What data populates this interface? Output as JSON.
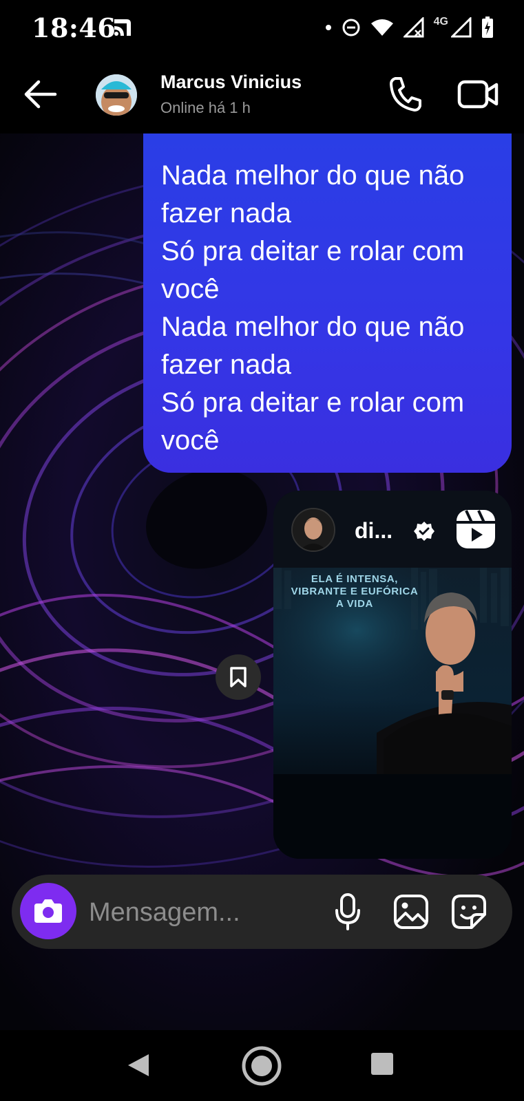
{
  "status_bar": {
    "time": "18:46",
    "network_label": "4G",
    "icons": [
      "cast-icon",
      "dot-icon",
      "do-not-disturb-icon",
      "wifi-icon",
      "signal-no-service-icon",
      "signal-icon",
      "battery-charging-icon"
    ]
  },
  "header": {
    "contact_name": "Marcus Vinicius",
    "contact_status": "Online há 1 h",
    "icons": [
      "back-arrow-icon",
      "phone-icon",
      "video-camera-icon"
    ]
  },
  "messages": [
    {
      "type": "text",
      "sender": "me",
      "lines": [
        "Nada melhor do que não",
        "fazer nada",
        "Só pra deitar e rolar com",
        "você",
        "Nada melhor do que não",
        "fazer nada",
        "Só pra deitar e rolar com",
        "você"
      ]
    },
    {
      "type": "reel",
      "sender": "me",
      "username": "di...",
      "verified": true,
      "caption_lines": [
        "ELA É INTENSA,",
        "VIBRANTE E EUFÓRICA",
        "A VIDA"
      ]
    }
  ],
  "composer": {
    "placeholder": "Mensagem...",
    "icons": [
      "camera-icon",
      "microphone-icon",
      "gallery-icon",
      "sticker-icon"
    ]
  },
  "colors": {
    "bubble": "#3338e6",
    "camera_button": "#7e2cf0",
    "composer_bg": "#262626"
  }
}
